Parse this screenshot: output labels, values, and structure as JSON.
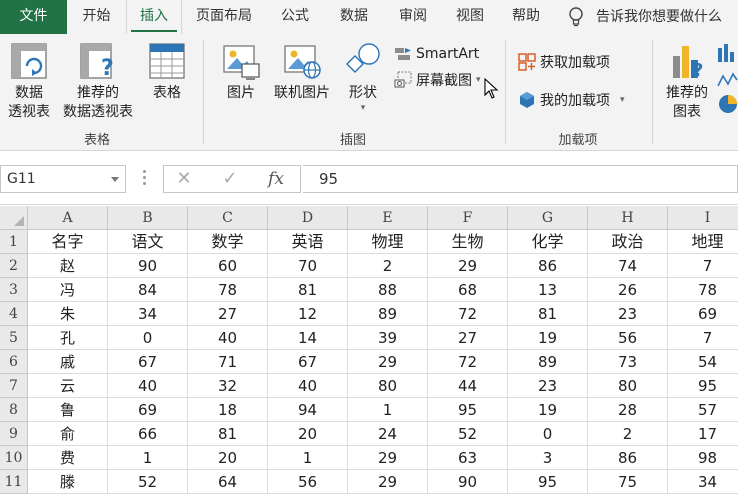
{
  "tabs": [
    {
      "label": "文件",
      "kind": "file"
    },
    {
      "label": "开始",
      "kind": "normal"
    },
    {
      "label": "插入",
      "kind": "active"
    },
    {
      "label": "页面布局",
      "kind": "normal"
    },
    {
      "label": "公式",
      "kind": "normal"
    },
    {
      "label": "数据",
      "kind": "normal"
    },
    {
      "label": "审阅",
      "kind": "normal"
    },
    {
      "label": "视图",
      "kind": "normal"
    },
    {
      "label": "帮助",
      "kind": "normal"
    }
  ],
  "tell_me": "告诉我你想要做什么",
  "ribbon": {
    "tables_group": {
      "label": "表格",
      "pivot_table": [
        "数据",
        "透视表"
      ],
      "recommended_pivot": [
        "推荐的",
        "数据透视表"
      ],
      "table": "表格"
    },
    "illustrations_group": {
      "label": "插图",
      "pictures": "图片",
      "online_pictures": "联机图片",
      "shapes": "形状",
      "smartart": "SmartArt",
      "screenshot": "屏幕截图"
    },
    "addins_group": {
      "label": "加载项",
      "get_addins": "获取加载项",
      "my_addins": "我的加载项"
    },
    "charts_group": {
      "recommended_charts": [
        "推荐的",
        "图表"
      ]
    }
  },
  "formula_bar": {
    "name_box": "G11",
    "cancel": "✕",
    "enter": "✓",
    "fx": "fx",
    "formula": "95"
  },
  "colors": {
    "accent": "#217346"
  },
  "sheet": {
    "columns": [
      "A",
      "B",
      "C",
      "D",
      "E",
      "F",
      "G",
      "H",
      "I"
    ],
    "rows": [
      [
        "名字",
        "语文",
        "数学",
        "英语",
        "物理",
        "生物",
        "化学",
        "政治",
        "地理"
      ],
      [
        "赵",
        "90",
        "60",
        "70",
        "2",
        "29",
        "86",
        "74",
        "7"
      ],
      [
        "冯",
        "84",
        "78",
        "81",
        "88",
        "68",
        "13",
        "26",
        "78"
      ],
      [
        "朱",
        "34",
        "27",
        "12",
        "89",
        "72",
        "81",
        "23",
        "69"
      ],
      [
        "孔",
        "0",
        "40",
        "14",
        "39",
        "27",
        "19",
        "56",
        "7"
      ],
      [
        "戚",
        "67",
        "71",
        "67",
        "29",
        "72",
        "89",
        "73",
        "54"
      ],
      [
        "云",
        "40",
        "32",
        "40",
        "80",
        "44",
        "23",
        "80",
        "95"
      ],
      [
        "鲁",
        "69",
        "18",
        "94",
        "1",
        "95",
        "19",
        "28",
        "57"
      ],
      [
        "俞",
        "66",
        "81",
        "20",
        "24",
        "52",
        "0",
        "2",
        "17"
      ],
      [
        "费",
        "1",
        "20",
        "1",
        "29",
        "63",
        "3",
        "86",
        "98"
      ],
      [
        "滕",
        "52",
        "64",
        "56",
        "29",
        "90",
        "95",
        "75",
        "34"
      ]
    ]
  }
}
